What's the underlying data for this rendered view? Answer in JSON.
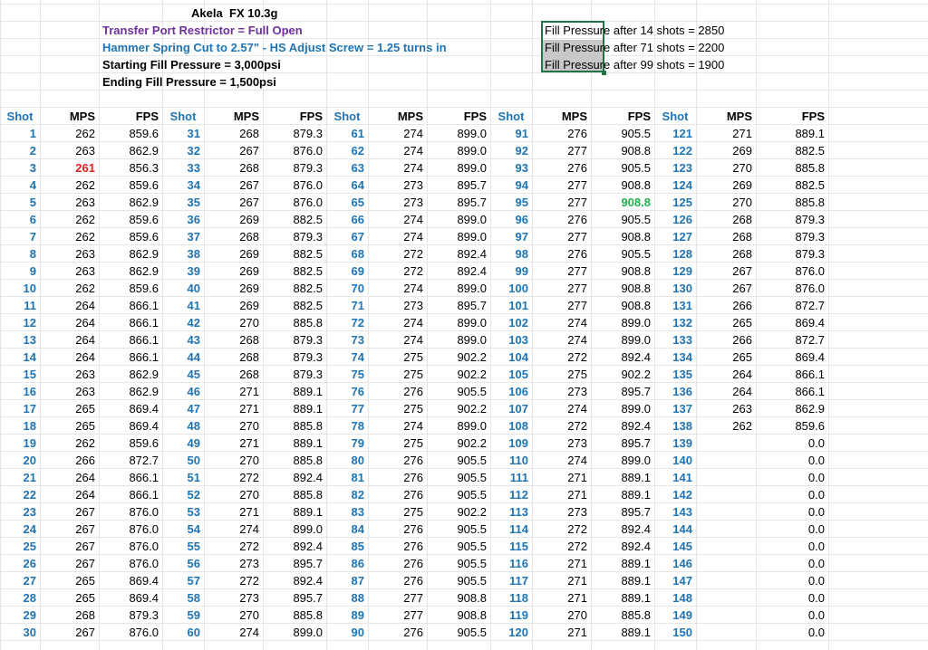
{
  "header": {
    "gun": "Akela",
    "pellet": "FX 10.3g",
    "restrictor": "Transfer Port Restrictor = Full Open",
    "hammer": "Hammer Spring Cut to 2.57\" - HS Adjust Screw = 1.25 turns in",
    "start_fill": "Starting Fill Pressure = 3,000psi",
    "end_fill": "Ending Fill Pressure = 1,500psi"
  },
  "notes": [
    "Fill Pressure after 14 shots = 2850",
    "Fill Pressure after 71 shots = 2200",
    "Fill Pressure after 99 shots = 1900"
  ],
  "colors": {
    "shot_blue": "#1f74b5",
    "low_red": "#e02020",
    "high_green": "#22b14c",
    "title_purple": "#7030a0",
    "title_blue": "#1f74b5"
  },
  "columns": [
    "Shot",
    "MPS",
    "FPS"
  ],
  "blocks": [
    {
      "shots": [
        "1",
        "2",
        "3",
        "4",
        "5",
        "6",
        "7",
        "8",
        "9",
        "10",
        "11",
        "12",
        "13",
        "14",
        "15",
        "16",
        "17",
        "18",
        "19",
        "20",
        "21",
        "22",
        "23",
        "24",
        "25",
        "26",
        "27",
        "28",
        "29",
        "30"
      ],
      "mps": [
        "262",
        "263",
        "261",
        "262",
        "263",
        "262",
        "262",
        "263",
        "263",
        "262",
        "264",
        "264",
        "264",
        "264",
        "263",
        "263",
        "265",
        "265",
        "262",
        "266",
        "264",
        "264",
        "267",
        "267",
        "267",
        "267",
        "265",
        "265",
        "268",
        "267"
      ],
      "fps": [
        "859.6",
        "862.9",
        "856.3",
        "859.6",
        "862.9",
        "859.6",
        "859.6",
        "862.9",
        "862.9",
        "859.6",
        "866.1",
        "866.1",
        "866.1",
        "866.1",
        "862.9",
        "862.9",
        "869.4",
        "869.4",
        "859.6",
        "872.7",
        "866.1",
        "866.1",
        "876.0",
        "876.0",
        "876.0",
        "876.0",
        "869.4",
        "869.4",
        "879.3",
        "876.0"
      ]
    },
    {
      "shots": [
        "31",
        "32",
        "33",
        "34",
        "35",
        "36",
        "37",
        "38",
        "39",
        "40",
        "41",
        "42",
        "43",
        "44",
        "45",
        "46",
        "47",
        "48",
        "49",
        "50",
        "51",
        "52",
        "53",
        "54",
        "55",
        "56",
        "57",
        "58",
        "59",
        "60"
      ],
      "mps": [
        "268",
        "267",
        "268",
        "267",
        "267",
        "269",
        "268",
        "269",
        "269",
        "269",
        "269",
        "270",
        "268",
        "268",
        "268",
        "271",
        "271",
        "270",
        "271",
        "270",
        "272",
        "270",
        "271",
        "274",
        "272",
        "273",
        "272",
        "273",
        "270",
        "274"
      ],
      "fps": [
        "879.3",
        "876.0",
        "879.3",
        "876.0",
        "876.0",
        "882.5",
        "879.3",
        "882.5",
        "882.5",
        "882.5",
        "882.5",
        "885.8",
        "879.3",
        "879.3",
        "879.3",
        "889.1",
        "889.1",
        "885.8",
        "889.1",
        "885.8",
        "892.4",
        "885.8",
        "889.1",
        "899.0",
        "892.4",
        "895.7",
        "892.4",
        "895.7",
        "885.8",
        "899.0"
      ]
    },
    {
      "shots": [
        "61",
        "62",
        "63",
        "64",
        "65",
        "66",
        "67",
        "68",
        "69",
        "70",
        "71",
        "72",
        "73",
        "74",
        "75",
        "76",
        "77",
        "78",
        "79",
        "80",
        "81",
        "82",
        "83",
        "84",
        "85",
        "86",
        "87",
        "88",
        "89",
        "90"
      ],
      "mps": [
        "274",
        "274",
        "274",
        "273",
        "273",
        "274",
        "274",
        "272",
        "272",
        "274",
        "273",
        "274",
        "274",
        "275",
        "275",
        "276",
        "275",
        "274",
        "275",
        "276",
        "276",
        "276",
        "275",
        "276",
        "276",
        "276",
        "276",
        "277",
        "277",
        "276"
      ],
      "fps": [
        "899.0",
        "899.0",
        "899.0",
        "895.7",
        "895.7",
        "899.0",
        "899.0",
        "892.4",
        "892.4",
        "899.0",
        "895.7",
        "899.0",
        "899.0",
        "902.2",
        "902.2",
        "905.5",
        "902.2",
        "899.0",
        "902.2",
        "905.5",
        "905.5",
        "905.5",
        "902.2",
        "905.5",
        "905.5",
        "905.5",
        "905.5",
        "908.8",
        "908.8",
        "905.5"
      ]
    },
    {
      "shots": [
        "91",
        "92",
        "93",
        "94",
        "95",
        "96",
        "97",
        "98",
        "99",
        "100",
        "101",
        "102",
        "103",
        "104",
        "105",
        "106",
        "107",
        "108",
        "109",
        "110",
        "111",
        "112",
        "113",
        "114",
        "115",
        "116",
        "117",
        "118",
        "119",
        "120"
      ],
      "mps": [
        "276",
        "277",
        "276",
        "277",
        "277",
        "276",
        "277",
        "276",
        "277",
        "277",
        "277",
        "274",
        "274",
        "272",
        "275",
        "273",
        "274",
        "272",
        "273",
        "274",
        "271",
        "271",
        "273",
        "272",
        "272",
        "271",
        "271",
        "271",
        "270",
        "271"
      ],
      "fps": [
        "905.5",
        "908.8",
        "905.5",
        "908.8",
        "908.8",
        "905.5",
        "908.8",
        "905.5",
        "908.8",
        "908.8",
        "908.8",
        "899.0",
        "899.0",
        "892.4",
        "902.2",
        "895.7",
        "899.0",
        "892.4",
        "895.7",
        "899.0",
        "889.1",
        "889.1",
        "895.7",
        "892.4",
        "892.4",
        "889.1",
        "889.1",
        "889.1",
        "885.8",
        "889.1"
      ]
    },
    {
      "shots": [
        "121",
        "122",
        "123",
        "124",
        "125",
        "126",
        "127",
        "128",
        "129",
        "130",
        "131",
        "132",
        "133",
        "134",
        "135",
        "136",
        "137",
        "138",
        "139",
        "140",
        "141",
        "142",
        "143",
        "144",
        "145",
        "146",
        "147",
        "148",
        "149",
        "150"
      ],
      "mps": [
        "271",
        "269",
        "270",
        "269",
        "270",
        "268",
        "268",
        "268",
        "267",
        "267",
        "266",
        "265",
        "266",
        "265",
        "264",
        "264",
        "263",
        "262",
        "",
        "",
        "",
        "",
        "",
        "",
        "",
        "",
        "",
        "",
        "",
        ""
      ],
      "fps": [
        "889.1",
        "882.5",
        "885.8",
        "882.5",
        "885.8",
        "879.3",
        "879.3",
        "879.3",
        "876.0",
        "876.0",
        "872.7",
        "869.4",
        "872.7",
        "869.4",
        "866.1",
        "866.1",
        "862.9",
        "859.6",
        "0.0",
        "0.0",
        "0.0",
        "0.0",
        "0.0",
        "0.0",
        "0.0",
        "0.0",
        "0.0",
        "0.0",
        "0.0",
        "0.0"
      ]
    }
  ],
  "highlights": {
    "red": [
      0,
      2
    ],
    "green": [
      3,
      4
    ]
  }
}
